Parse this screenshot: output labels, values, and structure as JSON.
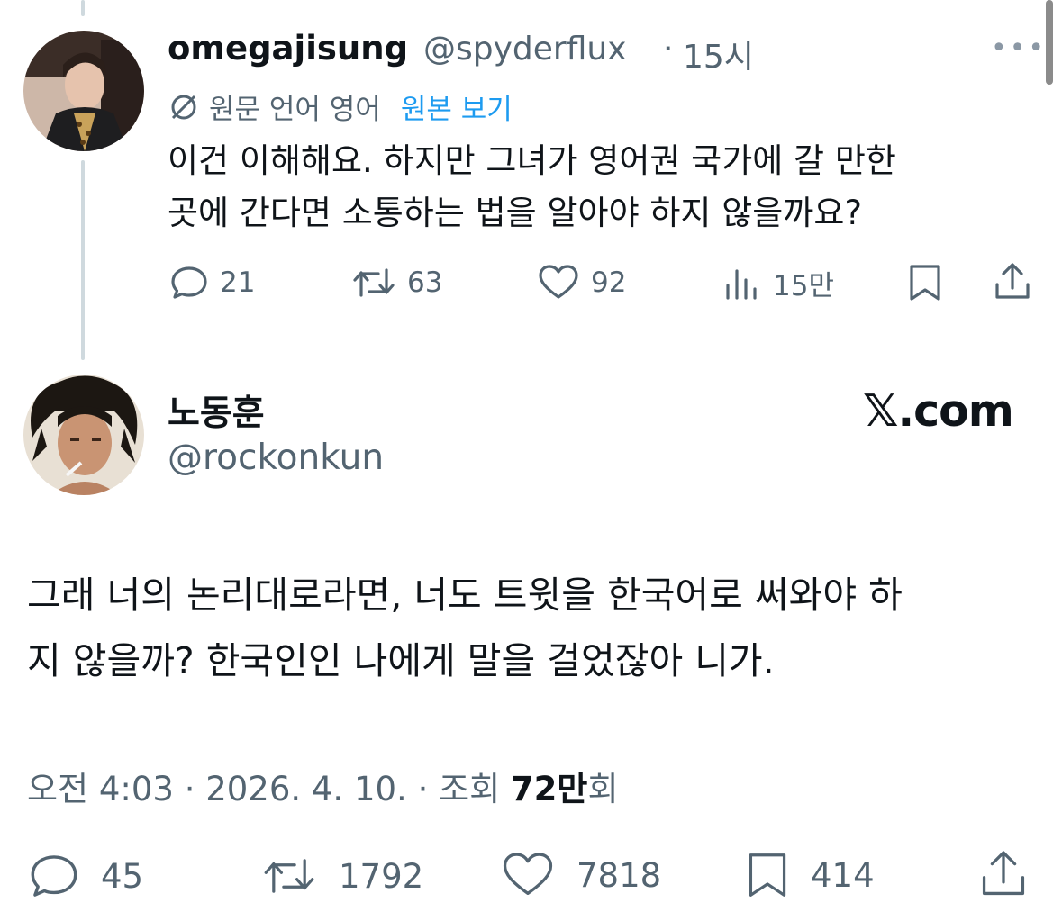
{
  "reply": {
    "display_name": "omegajisung",
    "handle": "@spyderflux",
    "time": "15시",
    "translation_note": "원문 언어 영어",
    "show_original": "원본 보기",
    "text_line1": "이건 이해해요. 하지만 그녀가 영어권 국가에 갈 만한",
    "text_line2": "곳에 간다면 소통하는 법을 알아야 하지 않을까요?",
    "stats": {
      "replies": "21",
      "reposts": "63",
      "likes": "92",
      "views": "15만"
    }
  },
  "main_tweet": {
    "display_name": "노동훈",
    "handle": "@rockonkun",
    "brand": "𝕏.com",
    "text_line1": "그래 너의 논리대로라면, 너도 트윗을 한국어로 써와야 하",
    "text_line2": "지 않을까? 한국인인 나에게 말을 걸었잖아 니가.",
    "timestamp": "오전 4:03 · 2026. 4. 10. · 조회",
    "views_bold": "72만",
    "views_suffix": "회",
    "stats": {
      "replies": "45",
      "reposts": "1792",
      "likes": "7818",
      "bookmarks": "414"
    }
  },
  "colors": {
    "accent": "#1d9bf0",
    "muted": "#536471",
    "text": "#0f1419",
    "thread_line": "#cfd9de"
  }
}
